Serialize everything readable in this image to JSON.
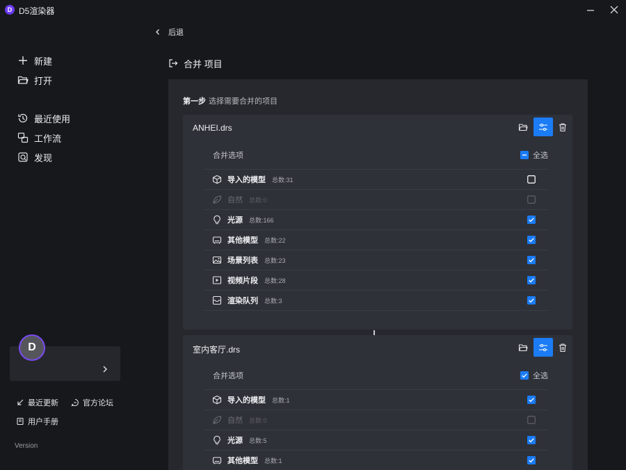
{
  "app": {
    "logo_letter": "D",
    "title": "D5渲染器"
  },
  "window_controls": [
    "minimize-icon",
    "close-icon"
  ],
  "nav": {
    "primary": [
      {
        "label": "新建",
        "icon": "plus-icon"
      },
      {
        "label": "打开",
        "icon": "folder-open-icon"
      }
    ],
    "secondary": [
      {
        "label": "最近使用",
        "icon": "history-icon"
      },
      {
        "label": "工作流",
        "icon": "workflow-icon"
      },
      {
        "label": "发现",
        "icon": "discover-icon"
      }
    ]
  },
  "profile": {
    "avatar_letter": "D"
  },
  "footer": {
    "recent_updates": "最近更新",
    "forum": "官方论坛",
    "manual": "用户手册",
    "version_label": "Version"
  },
  "header": {
    "back_label": "后退",
    "page_title": "合并 项目"
  },
  "step": {
    "label": "第一步",
    "description": "选择需要合并的项目"
  },
  "colors": {
    "accent": "#1b7cf5",
    "brand": "#6b3cf3",
    "background": "#17181c",
    "panel": "#26282e",
    "card": "#2f3138"
  },
  "cards": [
    {
      "file_name": "ANHEI.drs",
      "options_label": "合并选项",
      "select_all_label": "全选",
      "select_all_state": "partial",
      "rows": [
        {
          "label": "导入的模型",
          "count": "总数:31",
          "icon": "cube-icon",
          "checked": false,
          "disabled": false
        },
        {
          "label": "自然",
          "count": "总数:0",
          "icon": "leaf-icon",
          "checked": false,
          "disabled": true
        },
        {
          "label": "光源",
          "count": "总数:166",
          "icon": "bulb-icon",
          "checked": true,
          "disabled": false
        },
        {
          "label": "其他模型",
          "count": "总数:22",
          "icon": "sofa-icon",
          "checked": true,
          "disabled": false
        },
        {
          "label": "场景列表",
          "count": "总数:23",
          "icon": "image-icon",
          "checked": true,
          "disabled": false
        },
        {
          "label": "视频片段",
          "count": "总数:28",
          "icon": "video-icon",
          "checked": true,
          "disabled": false
        },
        {
          "label": "渲染队列",
          "count": "总数:3",
          "icon": "render-queue-icon",
          "checked": true,
          "disabled": false
        }
      ]
    },
    {
      "file_name": "室内客厅.drs",
      "options_label": "合并选项",
      "select_all_label": "全选",
      "select_all_state": "checked",
      "rows": [
        {
          "label": "导入的模型",
          "count": "总数:1",
          "icon": "cube-icon",
          "checked": true,
          "disabled": false
        },
        {
          "label": "自然",
          "count": "总数:0",
          "icon": "leaf-icon",
          "checked": false,
          "disabled": true
        },
        {
          "label": "光源",
          "count": "总数:5",
          "icon": "bulb-icon",
          "checked": true,
          "disabled": false
        },
        {
          "label": "其他模型",
          "count": "总数:1",
          "icon": "sofa-icon",
          "checked": true,
          "disabled": false
        }
      ]
    }
  ]
}
